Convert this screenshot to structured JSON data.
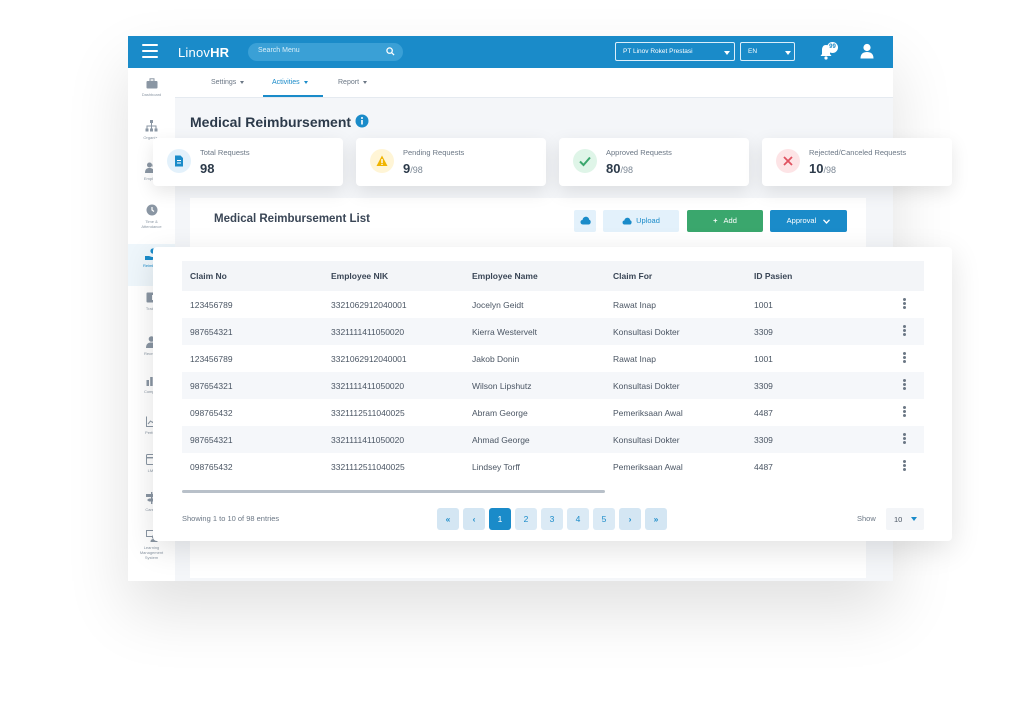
{
  "app": {
    "logo_light": "Linov",
    "logo_bold": "HR"
  },
  "search": {
    "placeholder": "Search Menu"
  },
  "company_select": {
    "value": "PT Linov Roket Prestasi"
  },
  "lang_select": {
    "value": "EN"
  },
  "notifications": {
    "count": "99"
  },
  "subnav": {
    "tabs": [
      {
        "label": "Settings"
      },
      {
        "label": "Activities"
      },
      {
        "label": "Report"
      }
    ]
  },
  "page": {
    "title": "Medical Reimbursement"
  },
  "stats": [
    {
      "label": "Total Requests",
      "value": "98",
      "of": "",
      "icon": "document-icon",
      "color": "#1a8bc9"
    },
    {
      "label": "Pending Requests",
      "value": "9",
      "of": "/98",
      "icon": "warning-icon",
      "color": "#f0b400"
    },
    {
      "label": "Approved Requests",
      "value": "80",
      "of": "/98",
      "icon": "check-icon",
      "color": "#3aa76d"
    },
    {
      "label": "Rejected/Canceled Requests",
      "value": "10",
      "of": "/98",
      "icon": "close-icon",
      "color": "#e05260"
    }
  ],
  "list": {
    "title": "Medical Reimbursement List",
    "upload_label": "Upload",
    "add_label": "Add",
    "approval_label": "Approval"
  },
  "table": {
    "headers": [
      "Claim No",
      "Employee NIK",
      "Employee Name",
      "Claim For",
      "ID Pasien"
    ],
    "rows": [
      [
        "123456789",
        "3321062912040001",
        "Jocelyn Geidt",
        "Rawat Inap",
        "1001"
      ],
      [
        "987654321",
        "3321111411050020",
        "Kierra Westervelt",
        "Konsultasi Dokter",
        "3309"
      ],
      [
        "123456789",
        "3321062912040001",
        "Jakob Donin",
        "Rawat Inap",
        "1001"
      ],
      [
        "987654321",
        "3321111411050020",
        "Wilson Lipshutz",
        "Konsultasi Dokter",
        "3309"
      ],
      [
        "098765432",
        "3321112511040025",
        "Abram George",
        "Pemeriksaan Awal",
        "4487"
      ],
      [
        "987654321",
        "3321111411050020",
        "Ahmad George",
        "Konsultasi Dokter",
        "3309"
      ],
      [
        "098765432",
        "3321112511040025",
        "Lindsey Torff",
        "Pemeriksaan Awal",
        "4487"
      ]
    ]
  },
  "pagination": {
    "info": "Showing 1 to 10 of 98 entries",
    "first": "«",
    "prev": "‹",
    "pages": [
      "1",
      "2",
      "3",
      "4",
      "5"
    ],
    "current": "1",
    "next": "›",
    "last": "»",
    "show_label": "Show",
    "page_size": "10"
  },
  "colors": {
    "primary": "#1a8bc9",
    "success": "#3aa76d",
    "warning": "#f0b400",
    "danger": "#e05260"
  }
}
